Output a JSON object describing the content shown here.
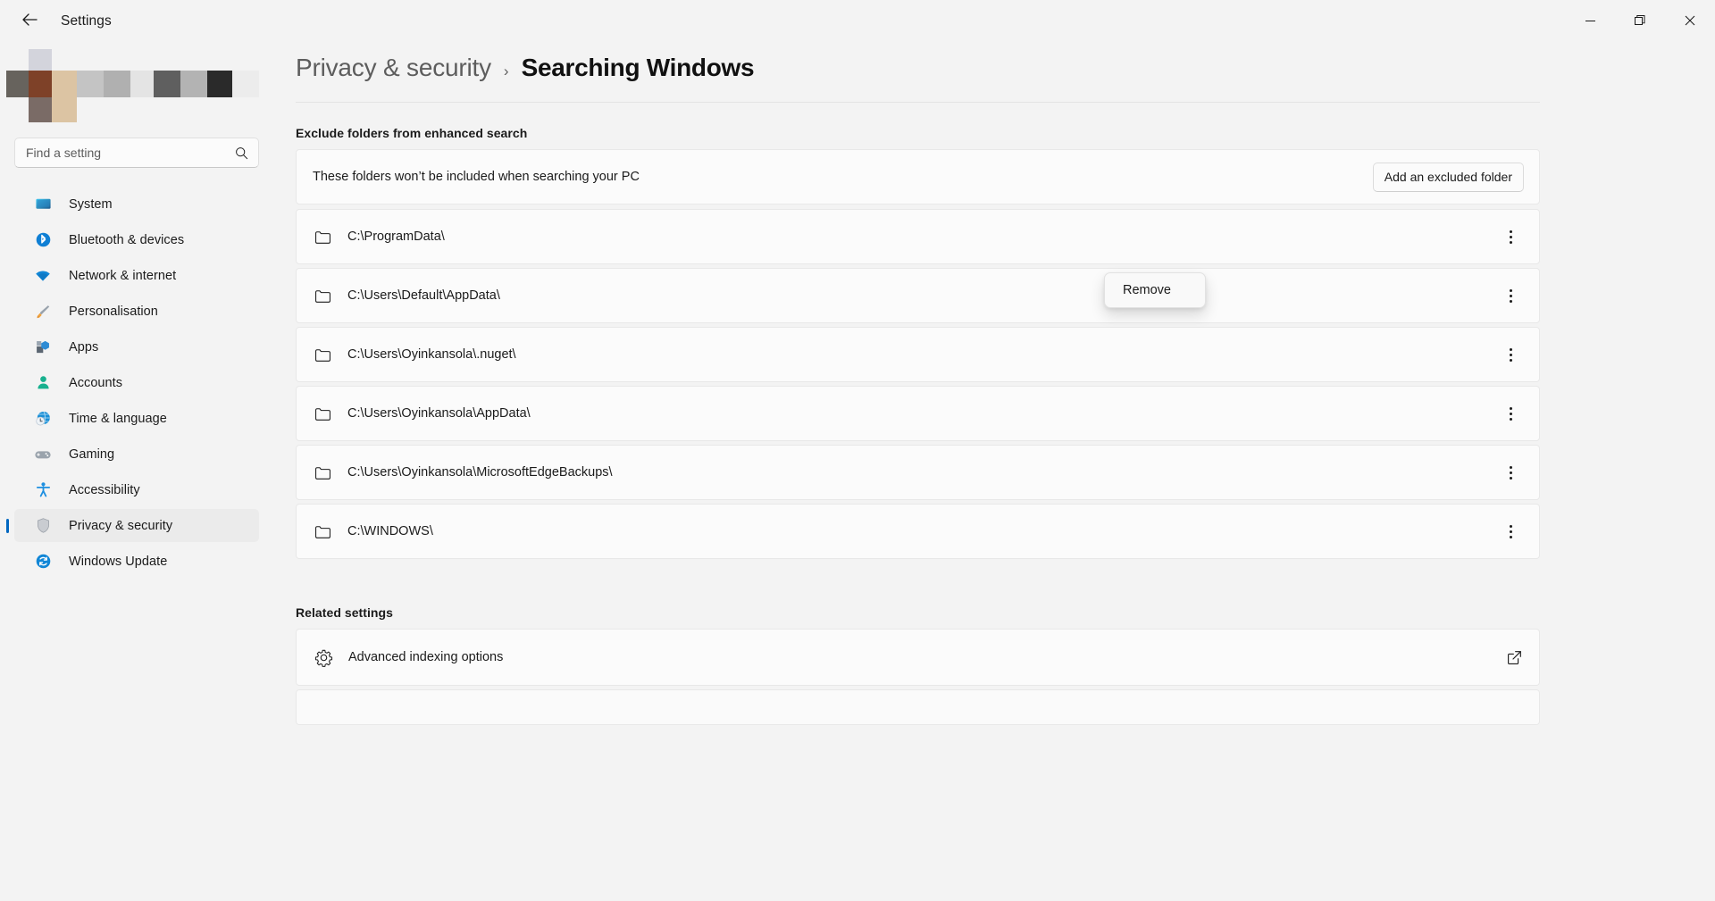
{
  "window": {
    "title": "Settings",
    "back_label": "←",
    "controls": {
      "minimize": "–",
      "restore": "❐",
      "close": "✕"
    }
  },
  "sidebar": {
    "search": {
      "placeholder": "Find a setting",
      "icon": "search-icon"
    },
    "items": [
      {
        "label": "System",
        "icon": "system-icon",
        "selected": false
      },
      {
        "label": "Bluetooth & devices",
        "icon": "bluetooth-icon",
        "selected": false
      },
      {
        "label": "Network & internet",
        "icon": "network-icon",
        "selected": false
      },
      {
        "label": "Personalisation",
        "icon": "brush-icon",
        "selected": false
      },
      {
        "label": "Apps",
        "icon": "apps-icon",
        "selected": false
      },
      {
        "label": "Accounts",
        "icon": "accounts-icon",
        "selected": false
      },
      {
        "label": "Time & language",
        "icon": "clock-globe-icon",
        "selected": false
      },
      {
        "label": "Gaming",
        "icon": "gamepad-icon",
        "selected": false
      },
      {
        "label": "Accessibility",
        "icon": "accessibility-icon",
        "selected": false
      },
      {
        "label": "Privacy & security",
        "icon": "shield-icon",
        "selected": true
      },
      {
        "label": "Windows Update",
        "icon": "update-icon",
        "selected": false
      }
    ],
    "accent_color": "#0067c0"
  },
  "breadcrumb": {
    "parent": "Privacy & security",
    "separator": "›",
    "current": "Searching Windows"
  },
  "exclude_section": {
    "title": "Exclude folders from enhanced search",
    "description": "These folders won’t be included when searching your PC",
    "add_button": "Add an excluded folder",
    "folders": [
      {
        "path": "C:\\ProgramData\\"
      },
      {
        "path": "C:\\Users\\Default\\AppData\\"
      },
      {
        "path": "C:\\Users\\Oyinkansola\\.nuget\\"
      },
      {
        "path": "C:\\Users\\Oyinkansola\\AppData\\"
      },
      {
        "path": "C:\\Users\\Oyinkansola\\MicrosoftEdgeBackups\\"
      },
      {
        "path": "C:\\WINDOWS\\"
      }
    ]
  },
  "context_menu": {
    "visible": true,
    "items": [
      "Remove"
    ]
  },
  "related_section": {
    "title": "Related settings",
    "items": [
      {
        "label": "Advanced indexing options",
        "icon": "gear-icon",
        "action_icon": "external-link-icon"
      }
    ]
  }
}
